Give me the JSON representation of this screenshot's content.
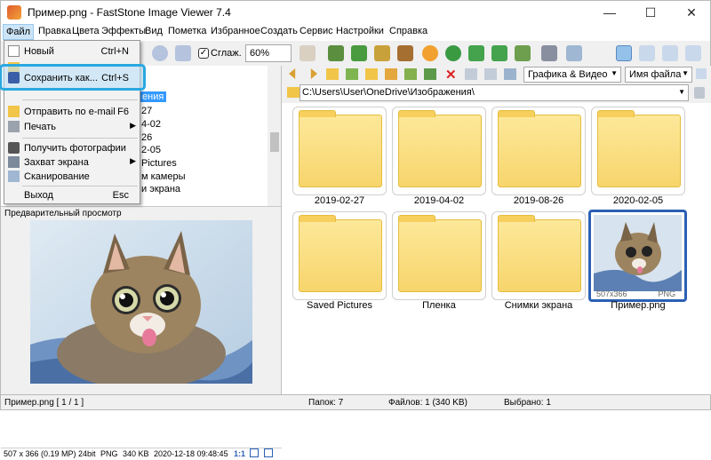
{
  "window": {
    "title": "Пример.png - FastStone Image Viewer 7.4",
    "minimize": "—",
    "maximize": "☐",
    "close": "✕"
  },
  "menubar": [
    "Файл",
    "Правка",
    "Цвета",
    "Эффекты",
    "Вид",
    "Пометка",
    "Избранное",
    "Создать",
    "Сервис",
    "Настройки",
    "Справка"
  ],
  "toolbar": {
    "smooth_label": "Сглаж.",
    "zoom_value": "60%"
  },
  "nav": {
    "filter_value": "Графика & Видео",
    "sort_value": "Имя файла"
  },
  "path": "C:\\Users\\User\\OneDrive\\Изображения\\",
  "file_menu": {
    "items": [
      {
        "label": "Новый",
        "shortcut": "Ctrl+N",
        "icon": "new-icon"
      },
      {
        "label": "Сохранить как...",
        "shortcut": "Ctrl+S",
        "icon": "save-icon"
      },
      {
        "label": "Отправить по e-mail",
        "shortcut": "F6",
        "icon": "email-icon"
      },
      {
        "label": "Печать",
        "shortcut": "",
        "icon": "print-icon"
      },
      {
        "label": "Получить фотографии",
        "shortcut": "",
        "icon": "camera-icon"
      },
      {
        "label": "Захват экрана",
        "shortcut": "",
        "icon": "capture-icon"
      },
      {
        "label": "Сканирование",
        "shortcut": "",
        "icon": "scan-icon"
      },
      {
        "label": "Выход",
        "shortcut": "Esc",
        "icon": ""
      }
    ]
  },
  "tree": [
    "ения",
    "27",
    "4-02",
    "26",
    "2-05",
    "Pictures",
    "м камеры",
    "и экрана"
  ],
  "preview": {
    "header": "Предварительный просмотр",
    "info": [
      "507 x 366 (0.19 MP)",
      "24bit",
      "PNG",
      "340 KB",
      "2020-12-18 09:48:45",
      "1:1"
    ]
  },
  "thumbnails": [
    {
      "caption": "2019-02-27"
    },
    {
      "caption": "2019-04-02"
    },
    {
      "caption": "2019-08-26"
    },
    {
      "caption": "2020-02-05"
    },
    {
      "caption": "Saved Pictures"
    },
    {
      "caption": "Пленка"
    },
    {
      "caption": "Снимки экрана"
    },
    {
      "caption": "Пример.png",
      "dims": "507x366",
      "format": "PNG"
    }
  ],
  "status": {
    "file": "Пример.png [ 1 / 1 ]",
    "folders": "Папок: 7",
    "files": "Файлов: 1 (340 KB)",
    "selected": "Выбрано: 1"
  }
}
